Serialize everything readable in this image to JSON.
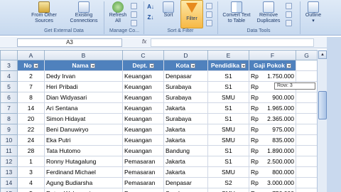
{
  "ribbon": {
    "from_other_sources": [
      "From Other",
      "Sources"
    ],
    "existing_connections": [
      "Existing",
      "Connections"
    ],
    "refresh_all": [
      "Refresh",
      "All"
    ],
    "sort": "Sort",
    "filter": "Filter",
    "convert_text": [
      "Convert Text",
      "to Table"
    ],
    "remove_duplicates": [
      "Remove",
      "Duplicates"
    ],
    "outline": "Outline",
    "groups": {
      "get_external_data": "Get External Data",
      "manage_connections": "Manage Co...",
      "sort_filter": "Sort & Filter",
      "data_tools": "Data Tools"
    }
  },
  "formula_bar": {
    "name_box": "A3",
    "fx": "fx",
    "formula": ""
  },
  "columns": [
    "A",
    "B",
    "C",
    "D",
    "E",
    "F",
    "G"
  ],
  "header_row": {
    "row_num": "3",
    "no": "No",
    "nama": "Nama",
    "dept": "Dept.",
    "kota": "Kota",
    "pendidikan": "Pendidika",
    "gaji": "Gaji Pokok"
  },
  "rows": [
    {
      "row": "4",
      "no": "2",
      "nama": "Dedy Irvan",
      "dept": "Keuangan",
      "kota": "Denpasar",
      "pend": "S1",
      "cur": "Rp",
      "gaji": "1.750.000"
    },
    {
      "row": "5",
      "no": "7",
      "nama": "Heri Pribadi",
      "dept": "Keuangan",
      "kota": "Surabaya",
      "pend": "S1",
      "cur": "Rp",
      "gaji": "1.3"
    },
    {
      "row": "6",
      "no": "8",
      "nama": "Dian Widyasari",
      "dept": "Keuangan",
      "kota": "Surabaya",
      "pend": "SMU",
      "cur": "Rp",
      "gaji": "900.000"
    },
    {
      "row": "7",
      "no": "14",
      "nama": "Ari Sentana",
      "dept": "Keuangan",
      "kota": "Jakarta",
      "pend": "S1",
      "cur": "Rp",
      "gaji": "1.965.000"
    },
    {
      "row": "8",
      "no": "20",
      "nama": "Simon Hidayat",
      "dept": "Keuangan",
      "kota": "Surabaya",
      "pend": "S1",
      "cur": "Rp",
      "gaji": "2.365.000"
    },
    {
      "row": "9",
      "no": "22",
      "nama": "Beni Danuwiryo",
      "dept": "Keuangan",
      "kota": "Jakarta",
      "pend": "SMU",
      "cur": "Rp",
      "gaji": "975.000"
    },
    {
      "row": "10",
      "no": "24",
      "nama": "Eka Putri",
      "dept": "Keuangan",
      "kota": "Jakarta",
      "pend": "SMU",
      "cur": "Rp",
      "gaji": "835.000"
    },
    {
      "row": "11",
      "no": "28",
      "nama": "Tata Hutomo",
      "dept": "Keuangan",
      "kota": "Bandung",
      "pend": "S1",
      "cur": "Rp",
      "gaji": "1.890.000"
    },
    {
      "row": "12",
      "no": "1",
      "nama": "Ronny Hutagalung",
      "dept": "Pemasaran",
      "kota": "Jakarta",
      "pend": "S1",
      "cur": "Rp",
      "gaji": "2.500.000"
    },
    {
      "row": "13",
      "no": "3",
      "nama": "Ferdinand Michael",
      "dept": "Pemasaran",
      "kota": "Jakarta",
      "pend": "SMU",
      "cur": "Rp",
      "gaji": "800.000"
    },
    {
      "row": "14",
      "no": "4",
      "nama": "Agung Budiarsha",
      "dept": "Pemasaran",
      "kota": "Denpasar",
      "pend": "S2",
      "cur": "Rp",
      "gaji": "3.000.000"
    },
    {
      "row": "15",
      "no": "5",
      "nama": "Ratna Wulansari",
      "dept": "Pemasaran",
      "kota": "Surabaya",
      "pend": "SMU",
      "cur": "Rp",
      "gaji": "750.000"
    }
  ],
  "tooltip": "Row: 3",
  "colors": {
    "header_fill": "#4f81bd",
    "ribbon_bg": "#dfeaf7"
  }
}
